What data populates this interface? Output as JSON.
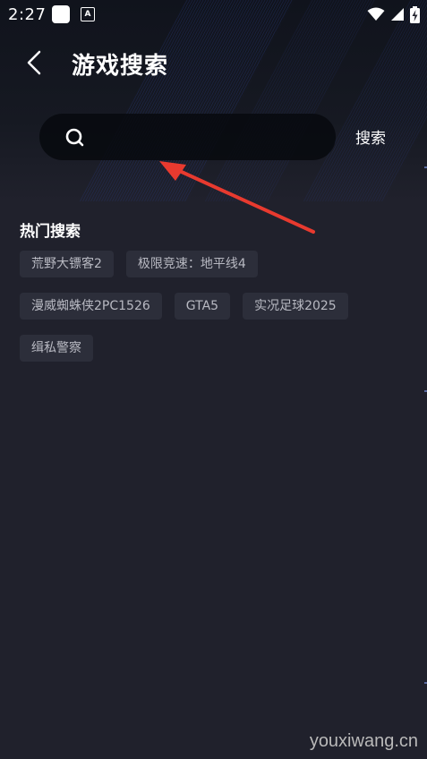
{
  "status_bar": {
    "time": "2:27",
    "app_badge_letter": "A",
    "icons": [
      "app-notification-icon",
      "a-badge-icon",
      "wifi-icon",
      "signal-icon",
      "battery-charging-icon"
    ]
  },
  "header": {
    "back_icon": "back-chevron-icon",
    "title": "游戏搜索"
  },
  "search": {
    "icon": "search-icon",
    "value": "",
    "placeholder": "",
    "button_label": "搜索"
  },
  "hot_search": {
    "title": "热门搜索",
    "tags": [
      "荒野大镖客2",
      "极限竞速：地平线4",
      "漫威蜘蛛侠2PC1526",
      "GTA5",
      "实况足球2025",
      "缉私警察"
    ]
  },
  "annotation": {
    "arrow_color": "#e83a2f"
  },
  "watermark": "youxiwang.cn",
  "colors": {
    "background": "#20212c",
    "tag_background": "#2c2e3a",
    "search_background": "#07090e"
  }
}
